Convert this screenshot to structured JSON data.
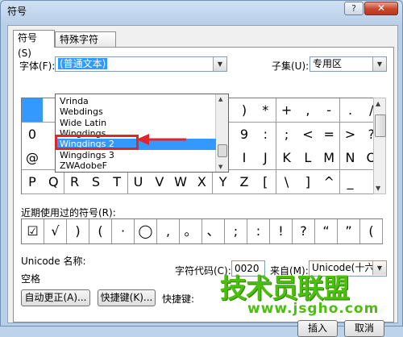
{
  "window": {
    "title": "符号",
    "help_label": "?",
    "close_label": "✕"
  },
  "tabs": [
    {
      "label": "符号(S)"
    },
    {
      "label": "特殊字符(P)"
    }
  ],
  "font": {
    "label": "字体(F):",
    "value": "(普通文本)"
  },
  "subset": {
    "label": "子集(U):",
    "value": "专用区"
  },
  "font_dropdown": {
    "items": [
      "Vrinda",
      "Webdings",
      "Wide Latin",
      "Wingdings",
      "Wingdings 2",
      "Wingdings 3",
      "ZWAdobeF"
    ],
    "highlighted": "Wingdings 2"
  },
  "symbol_grid": {
    "rows": [
      [
        "",
        "",
        "",
        "",
        "",
        "",
        "",
        "",
        "",
        "",
        ")",
        "*",
        "+",
        ",",
        "-",
        ".",
        "/"
      ],
      [
        "0",
        "",
        "",
        "",
        "",
        "",
        "",
        "",
        "",
        "",
        "9",
        ":",
        ";",
        "<",
        "=",
        ">",
        "?"
      ],
      [
        "@",
        "",
        "",
        "",
        "",
        "",
        "",
        "",
        "",
        "",
        "I",
        "J",
        "K",
        "L",
        "M",
        "N",
        "O"
      ],
      [
        "P",
        "Q",
        "R",
        "S",
        "T",
        "U",
        "V",
        "W",
        "X",
        "Y",
        "Z",
        "[",
        "\\",
        "]",
        "^",
        "_",
        ""
      ]
    ]
  },
  "recent": {
    "label": "近期使用过的符号(R):",
    "symbols": [
      "☑",
      "√",
      ")",
      "(",
      "·",
      "◯",
      ",",
      "。",
      "、",
      ";",
      ":",
      "!",
      "?",
      "“",
      "”",
      "("
    ]
  },
  "unicode_name": {
    "label": "Unicode 名称:",
    "value": "空格"
  },
  "char_code": {
    "label": "字符代码(C):",
    "value": "0020"
  },
  "from": {
    "label": "来自(M):",
    "value": "Unicode(十六进"
  },
  "buttons": {
    "autocorrect": "自动更正(A)...",
    "shortcut": "快捷键(K)...",
    "shortcut_label": "快捷键:",
    "insert": "插入",
    "cancel": "取消"
  },
  "watermark": {
    "text": "技术员联盟",
    "url": "www.jsgho.com"
  },
  "colors": {
    "selection": "#3399ff",
    "annotation_red": "#e0252c",
    "watermark_green": "#4ac00d"
  }
}
